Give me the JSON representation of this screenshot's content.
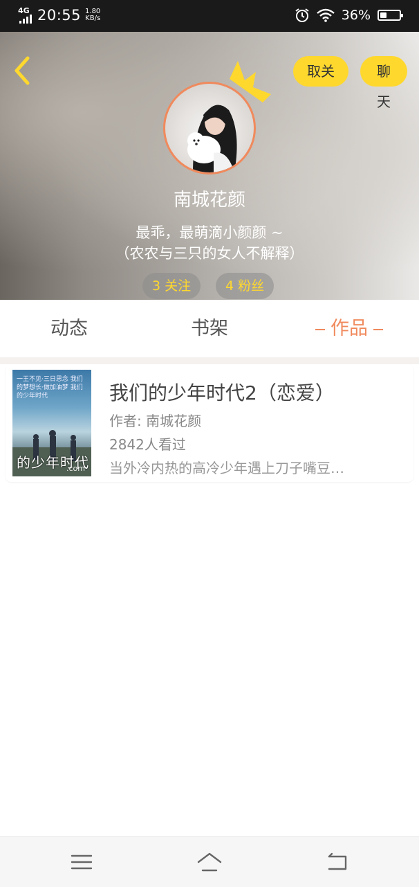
{
  "status_bar": {
    "network": "4G",
    "time": "20:55",
    "speed_value": "1.80",
    "speed_unit": "KB/s",
    "battery_percent": "36%",
    "battery_level": 0.36
  },
  "header": {
    "unfollow_label": "取关",
    "chat_label": "聊天",
    "username": "南城花颜",
    "bio_line1": "最乖，最萌滴小颜颜 ~",
    "bio_line2": "（农农与三只的女人不解释）",
    "following_label": "3 关注",
    "fans_label": "4 粉丝",
    "accent_color": "#ffd82e"
  },
  "tabs": [
    {
      "label": "动态",
      "active": false
    },
    {
      "label": "书架",
      "active": false
    },
    {
      "label": "作品",
      "active": true
    }
  ],
  "works": [
    {
      "title": "我们的少年时代2（恋爱）",
      "author": "作者: 南城花颜",
      "views": "2842人看过",
      "description": "当外冷内热的高冷少年遇上刀子嘴豆…",
      "cover_text": "一王不见·三日思念 我们的梦想长·做加油梦 我们的少年时代",
      "cover_title": "的少年时代",
      "cover_suffix": ".com"
    }
  ],
  "nav": {
    "menu_icon": "menu-icon",
    "home_icon": "home-icon",
    "back_icon": "back-icon"
  },
  "colors": {
    "active_tab": "#f08a5d",
    "pill_bg": "#ffd82e"
  }
}
